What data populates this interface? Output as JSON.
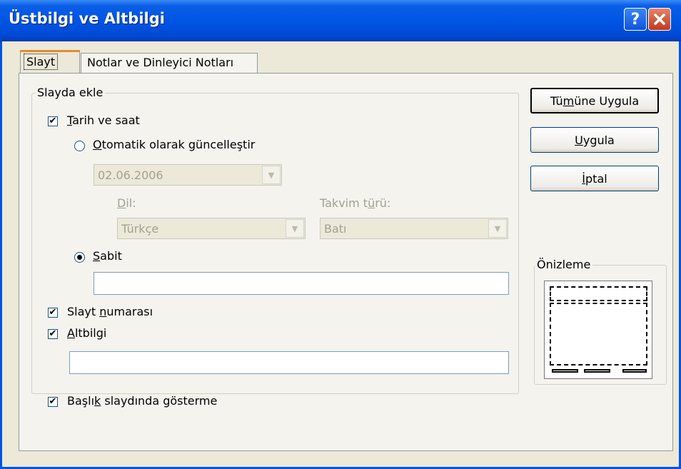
{
  "window": {
    "title": "Üstbilgi ve Altbilgi",
    "help_icon": "?",
    "close_icon": "✕"
  },
  "tabs": [
    {
      "label": "Slayt",
      "active": true
    },
    {
      "label": "Notlar ve Dinleyici Notları",
      "active": false
    }
  ],
  "slayda_ekle": {
    "legend": "Slayda ekle",
    "tarih_ve_saat": {
      "pre": "",
      "key": "T",
      "post": "arih ve saat",
      "checked": true
    },
    "otomatik": {
      "pre": "",
      "key": "O",
      "post": "tomatik olarak güncelleştir",
      "selected": false
    },
    "date_value": "02.06.2006",
    "dil": {
      "pre": "",
      "key": "D",
      "post": "il:",
      "value": "Türkçe"
    },
    "takvim": {
      "pre": "Takvim t",
      "key": "ü",
      "post": "rü:",
      "value": "Batı"
    },
    "sabit": {
      "pre": "",
      "key": "S",
      "post": "abit",
      "selected": true,
      "value": ""
    },
    "slayt_numarasi": {
      "pre": "Slayt ",
      "key": "n",
      "post": "umarası",
      "checked": true
    },
    "altbilgi": {
      "pre": "",
      "key": "A",
      "post": "ltbilgi",
      "checked": true,
      "value": ""
    }
  },
  "baslik": {
    "pre": "Başlı",
    "key": "k",
    "post": " slaydında gösterme",
    "checked": true
  },
  "buttons": {
    "apply_all": {
      "pre": "Tü",
      "key": "m",
      "post": "üne Uygula"
    },
    "apply": {
      "pre": "",
      "key": "U",
      "post": "ygula"
    },
    "cancel": {
      "pre": "",
      "key": "İ",
      "post": "ptal"
    }
  },
  "preview": {
    "legend": "Önizleme"
  },
  "colors": {
    "titlebar": "#0055e5",
    "face": "#ece9d8",
    "tab_accent": "#e68b2c"
  }
}
